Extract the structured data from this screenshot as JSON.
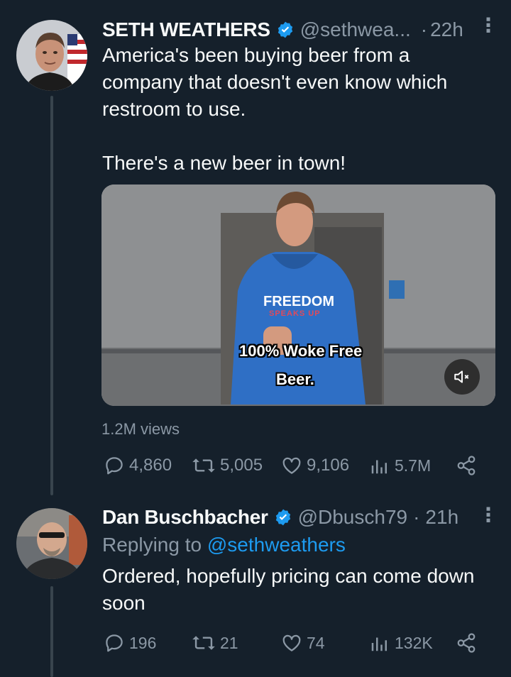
{
  "tweet": {
    "author_name": "SETH WEATHERS",
    "handle": "@sethwea...",
    "separator": "·",
    "time": "22h",
    "text_line1": "America's been buying beer from a",
    "text_line2": "company that doesn't even know which",
    "text_line3": "restroom to use.",
    "text_line4": "There's a new beer in town!",
    "media": {
      "caption_line1": "100% Woke Free",
      "caption_line2": "Beer.",
      "shirt_text": "FREEDOM",
      "shirt_sub": "SPEAKS UP",
      "mute_icon": "speaker-muted-icon"
    },
    "views": "1.2M views",
    "stats": {
      "replies": "4,860",
      "retweets": "5,005",
      "likes": "9,106",
      "analytics": "5.7M"
    }
  },
  "reply": {
    "author_name": "Dan Buschbacher",
    "handle": "@Dbusch79",
    "separator": "·",
    "time": "21h",
    "replying_prefix": "Replying to",
    "replying_handle": "@sethweathers",
    "text_line1": "Ordered, hopefully pricing can come down",
    "text_line2": "soon",
    "stats": {
      "replies": "196",
      "retweets": "21",
      "likes": "74",
      "analytics": "132K"
    }
  },
  "colors": {
    "background": "#15202b",
    "muted": "#8b98a5",
    "accent": "#1d9bf0",
    "thread_line": "#38444d"
  }
}
